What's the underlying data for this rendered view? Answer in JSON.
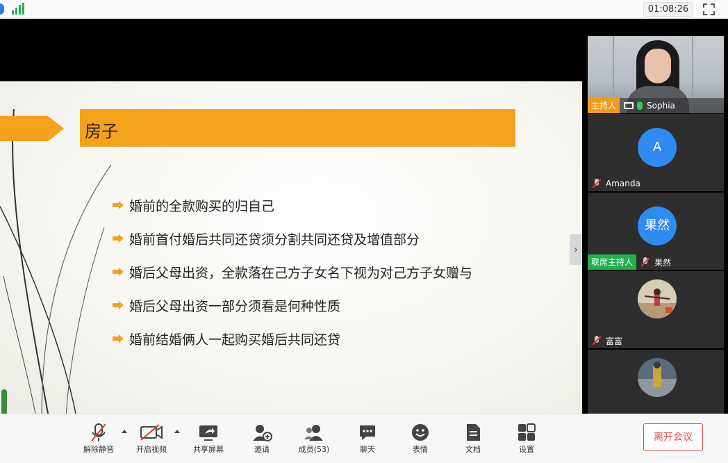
{
  "topbar": {
    "timer": "01:08:26",
    "icons": [
      "info-icon",
      "signal-icon",
      "fullscreen-icon"
    ]
  },
  "slide": {
    "title": "房子",
    "bullets": [
      "婚前的全款购买的归自己",
      "婚前首付婚后共同还贷须分割共同还贷及增值部分",
      "婚后父母出资，全款落在己方子女名下视为对己方子女赠与",
      "婚后父母出资一部分须看是何种性质",
      "婚前结婚俩人一起购买婚后共同还贷"
    ],
    "accent_color": "#f4a11c"
  },
  "participants": {
    "host": {
      "badge": "主持人",
      "name": "Sophia"
    },
    "tiles": [
      {
        "avatar": "A",
        "name": "Amanda",
        "avatar_color": "#2f8af2"
      },
      {
        "avatar": "果然",
        "name": "果然",
        "badge": "联席主持人",
        "avatar_color": "#2f8af2"
      },
      {
        "avatar": "",
        "name": "富富"
      },
      {
        "avatar": "",
        "name": ""
      }
    ]
  },
  "toolbar": {
    "unmute": "解除静音",
    "start_video": "开启视频",
    "share_screen": "共享屏幕",
    "invite": "邀请",
    "members": "成员(53)",
    "chat": "聊天",
    "reactions": "表情",
    "docs": "文档",
    "settings": "设置",
    "leave": "离开会议"
  }
}
